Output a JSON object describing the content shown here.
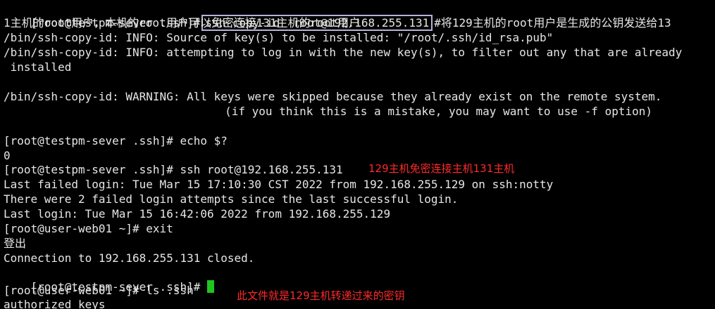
{
  "colors": {
    "background": "#000000",
    "text": "#e6e6e6",
    "annotation": "#ff2a2a",
    "cursor": "#1ec61e",
    "highlight_box": "#b6b2d6"
  },
  "lines": {
    "l1_prompt": "[root@testpm-sever .ssh]#",
    "l1_cmd": "ssh-copy-id  root@192.168.255.131",
    "l1_comment": "#将129主机的root用户是生成的公钥发送给13",
    "l2": "1主机的root用户，本机的root用户可以免密连接131主机的root用户",
    "l3": "/bin/ssh-copy-id: INFO: Source of key(s) to be installed: \"/root/.ssh/id_rsa.pub\"",
    "l4": "/bin/ssh-copy-id: INFO: attempting to log in with the new key(s), to filter out any that are already",
    "l5": " installed",
    "l6": "/bin/ssh-copy-id: WARNING: All keys were skipped because they already exist on the remote system.",
    "l7": "\t\t(if you think this is a mistake, you may want to use -f option)",
    "l8": "[root@testpm-sever .ssh]# echo $?",
    "l9": "0",
    "l10": "[root@testpm-sever .ssh]# ssh root@192.168.255.131",
    "l11": "Last failed login: Tue Mar 15 17:10:30 CST 2022 from 192.168.255.129 on ssh:notty",
    "l12": "There were 2 failed login attempts since the last successful login.",
    "l13": "Last login: Tue Mar 15 16:42:06 2022 from 192.168.255.129",
    "l14": "[root@user-web01 ~]# exit",
    "l15": "登出",
    "l16": "Connection to 192.168.255.131 closed.",
    "l17_prompt": "[root@testpm-sever .ssh]#",
    "l18": "[root@user-web01 ~]# ls .ssh",
    "l19": "authorized_keys"
  },
  "annotations": {
    "ssh_note": "129主机免密连接主机131主机",
    "keys_note": "此文件就是129主机转递过来的密钥"
  }
}
